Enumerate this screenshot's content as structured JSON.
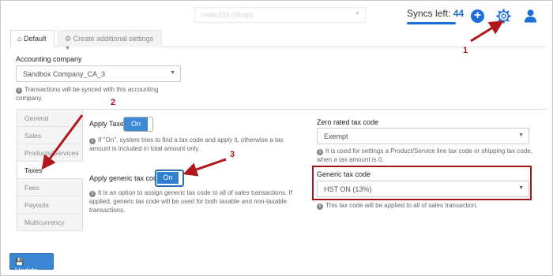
{
  "topbar": {
    "shop_select_value": "Hello333 (Shop)",
    "syncs_label": "Syncs left:",
    "syncs_value": "44"
  },
  "tabs": [
    {
      "label": "Default",
      "icon": "home-icon",
      "active": true
    },
    {
      "label": "Create additional settings",
      "icon": "gear-icon",
      "active": false
    }
  ],
  "accounting": {
    "label": "Accounting company",
    "value": "Sandbox Company_CA_3",
    "help": "Transactions will be synced with this accounting company."
  },
  "sidenav": [
    {
      "label": "General"
    },
    {
      "label": "Sales"
    },
    {
      "label": "Products/Services"
    },
    {
      "label": "Taxes",
      "active": true
    },
    {
      "label": "Fees"
    },
    {
      "label": "Payouts"
    },
    {
      "label": "Multicurrency"
    }
  ],
  "taxes": {
    "apply_taxes_label": "Apply Taxes",
    "apply_taxes_toggle": "On",
    "apply_taxes_help": "If \"On\", system tries to find a tax code and apply it, otherwise a tax amount is included in total amount only.",
    "generic_label": "Apply generic tax code",
    "generic_toggle": "On",
    "generic_help": "It is an option to assign generic tax code to all of sales transactions. If applied, generic tax code will be used for both taxable and non-taxable transactions.",
    "zero_label": "Zero rated tax code",
    "zero_value": "Exempt",
    "zero_help": "It is used for settings a Product/Service line tax code or shipping tax code, when a tax amount is 0.",
    "generic_code_label": "Generic tax code",
    "generic_code_value": "HST ON (13%)",
    "generic_code_help": "This tax code will be applied to all of sales transaction."
  },
  "update_label": "Update",
  "annotations": {
    "one": "1",
    "two": "2",
    "three": "3"
  },
  "colors": {
    "accent": "#1f6fd1",
    "annotation_red": "#b0161b"
  }
}
